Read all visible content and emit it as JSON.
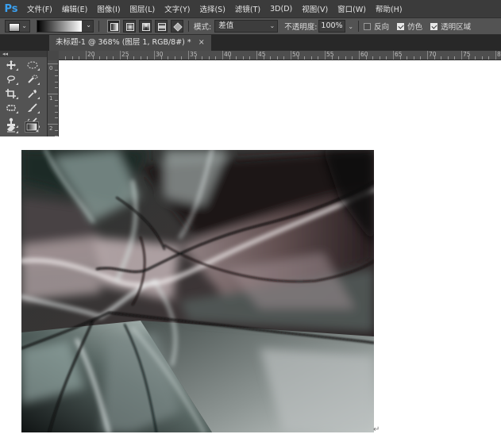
{
  "app": {
    "logo": "Ps"
  },
  "menu": [
    "文件(F)",
    "编辑(E)",
    "图像(I)",
    "图层(L)",
    "文字(Y)",
    "选择(S)",
    "滤镜(T)",
    "3D(D)",
    "视图(V)",
    "窗口(W)",
    "帮助(H)"
  ],
  "options": {
    "mode_label": "模式:",
    "mode_value": "差值",
    "opacity_label": "不透明度:",
    "opacity_value": "100%",
    "reverse_label": "反向",
    "reverse_checked": false,
    "dither_label": "仿色",
    "dither_checked": true,
    "transparency_label": "透明区域",
    "transparency_checked": true
  },
  "document": {
    "tab_title": "未标题-1 @ 368% (图层 1, RGB/8#) *",
    "close_glyph": "×"
  },
  "ruler": {
    "h_labels": [
      "20",
      "25",
      "30",
      "35",
      "40",
      "45",
      "50",
      "55",
      "60",
      "65",
      "70",
      "75",
      "80"
    ],
    "v_labels": [
      "0",
      "1",
      "2"
    ]
  },
  "toolbox": {
    "collapse_glyph": "◂◂",
    "tools": [
      "move-tool",
      "marquee-tool",
      "lasso-tool",
      "quick-selection-tool",
      "crop-tool",
      "eyedropper-tool",
      "spot-healing-tool",
      "brush-tool",
      "clone-stamp-tool",
      "history-brush-tool",
      "eraser-tool",
      "gradient-tool"
    ],
    "active_tool": "gradient-tool"
  },
  "canvas": {
    "return_mark": "↵"
  },
  "colors": {
    "menubar": "#3b3b3b",
    "panel": "#535353",
    "logo": "#3aa0f0"
  }
}
